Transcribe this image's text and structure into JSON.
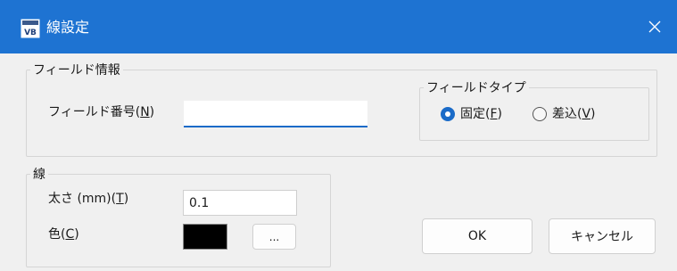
{
  "window": {
    "title": "線設定",
    "app_icon": "vb-app-icon",
    "close_icon": "close-icon",
    "titlebar_color": "#1e73d2"
  },
  "field_info": {
    "legend": "フィールド情報",
    "number_label_prefix": "フィールド番号(",
    "number_label_mnemonic": "N",
    "number_label_suffix": ")",
    "number_value": ""
  },
  "field_type": {
    "legend": "フィールドタイプ",
    "options": [
      {
        "label_prefix": "固定(",
        "mnemonic": "F",
        "label_suffix": ")",
        "selected": true
      },
      {
        "label_prefix": "差込(",
        "mnemonic": "V",
        "label_suffix": ")",
        "selected": false
      }
    ]
  },
  "line": {
    "legend": "線",
    "width_label_prefix": "太さ (mm)(",
    "width_label_mnemonic": "T",
    "width_label_suffix": ")",
    "width_value": "0.1",
    "color_label_prefix": "色(",
    "color_label_mnemonic": "C",
    "color_label_suffix": ")",
    "color_value": "#000000",
    "color_picker_label": "..."
  },
  "buttons": {
    "ok": "OK",
    "cancel": "キャンセル"
  }
}
